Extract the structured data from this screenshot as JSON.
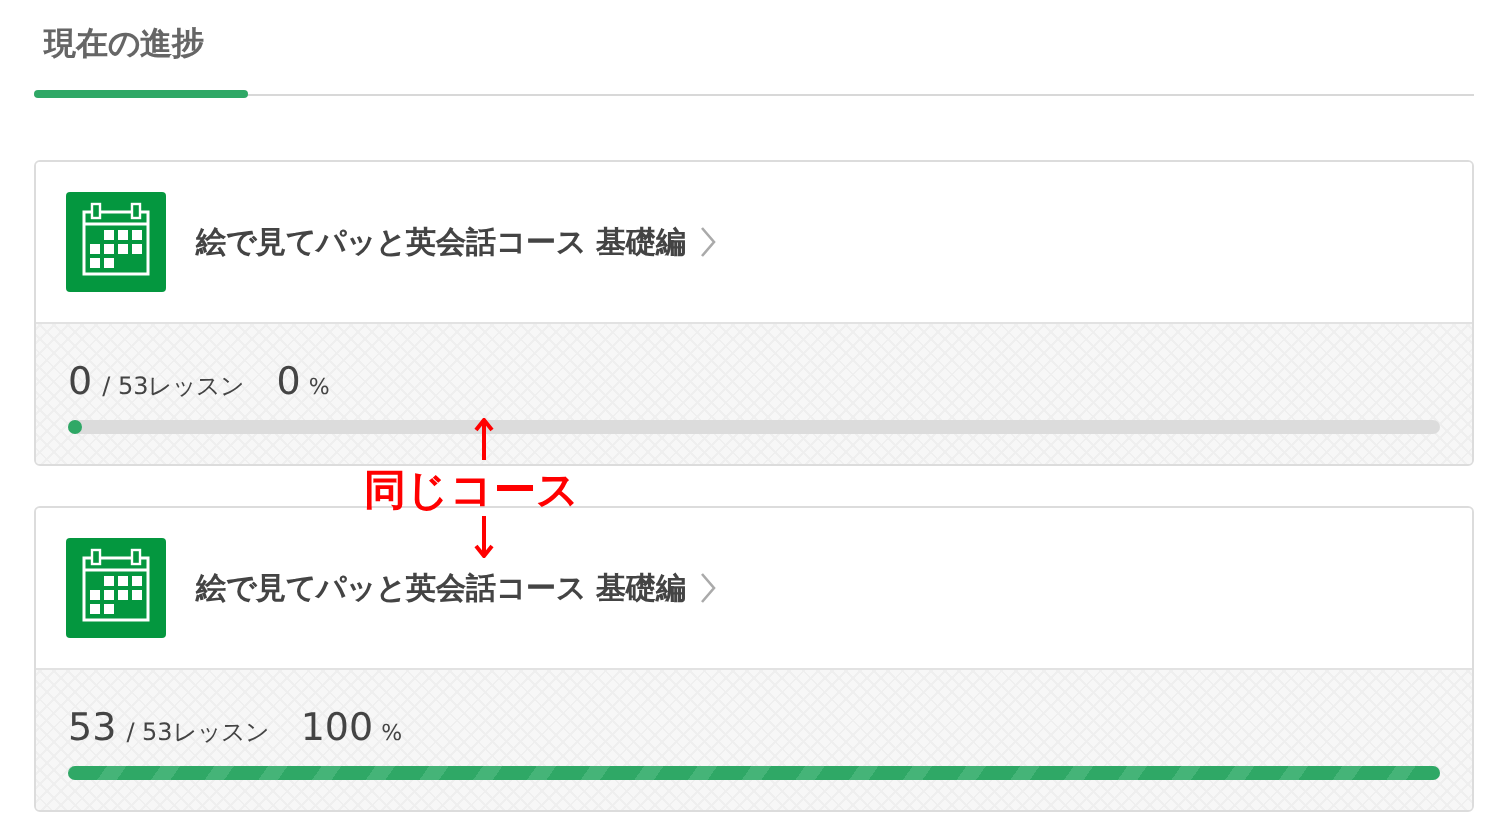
{
  "section": {
    "title": "現在の進捗"
  },
  "courses": [
    {
      "title": "絵で見てパッと英会話コース 基礎編",
      "done": "0",
      "total": "/ 53レッスン",
      "percent": "0",
      "unit": "%",
      "level": 0
    },
    {
      "title": "絵で見てパッと英会話コース 基礎編",
      "done": "53",
      "total": "/ 53レッスン",
      "percent": "100",
      "unit": "%",
      "level": 1
    }
  ],
  "annotation": {
    "text": "同じコース"
  }
}
